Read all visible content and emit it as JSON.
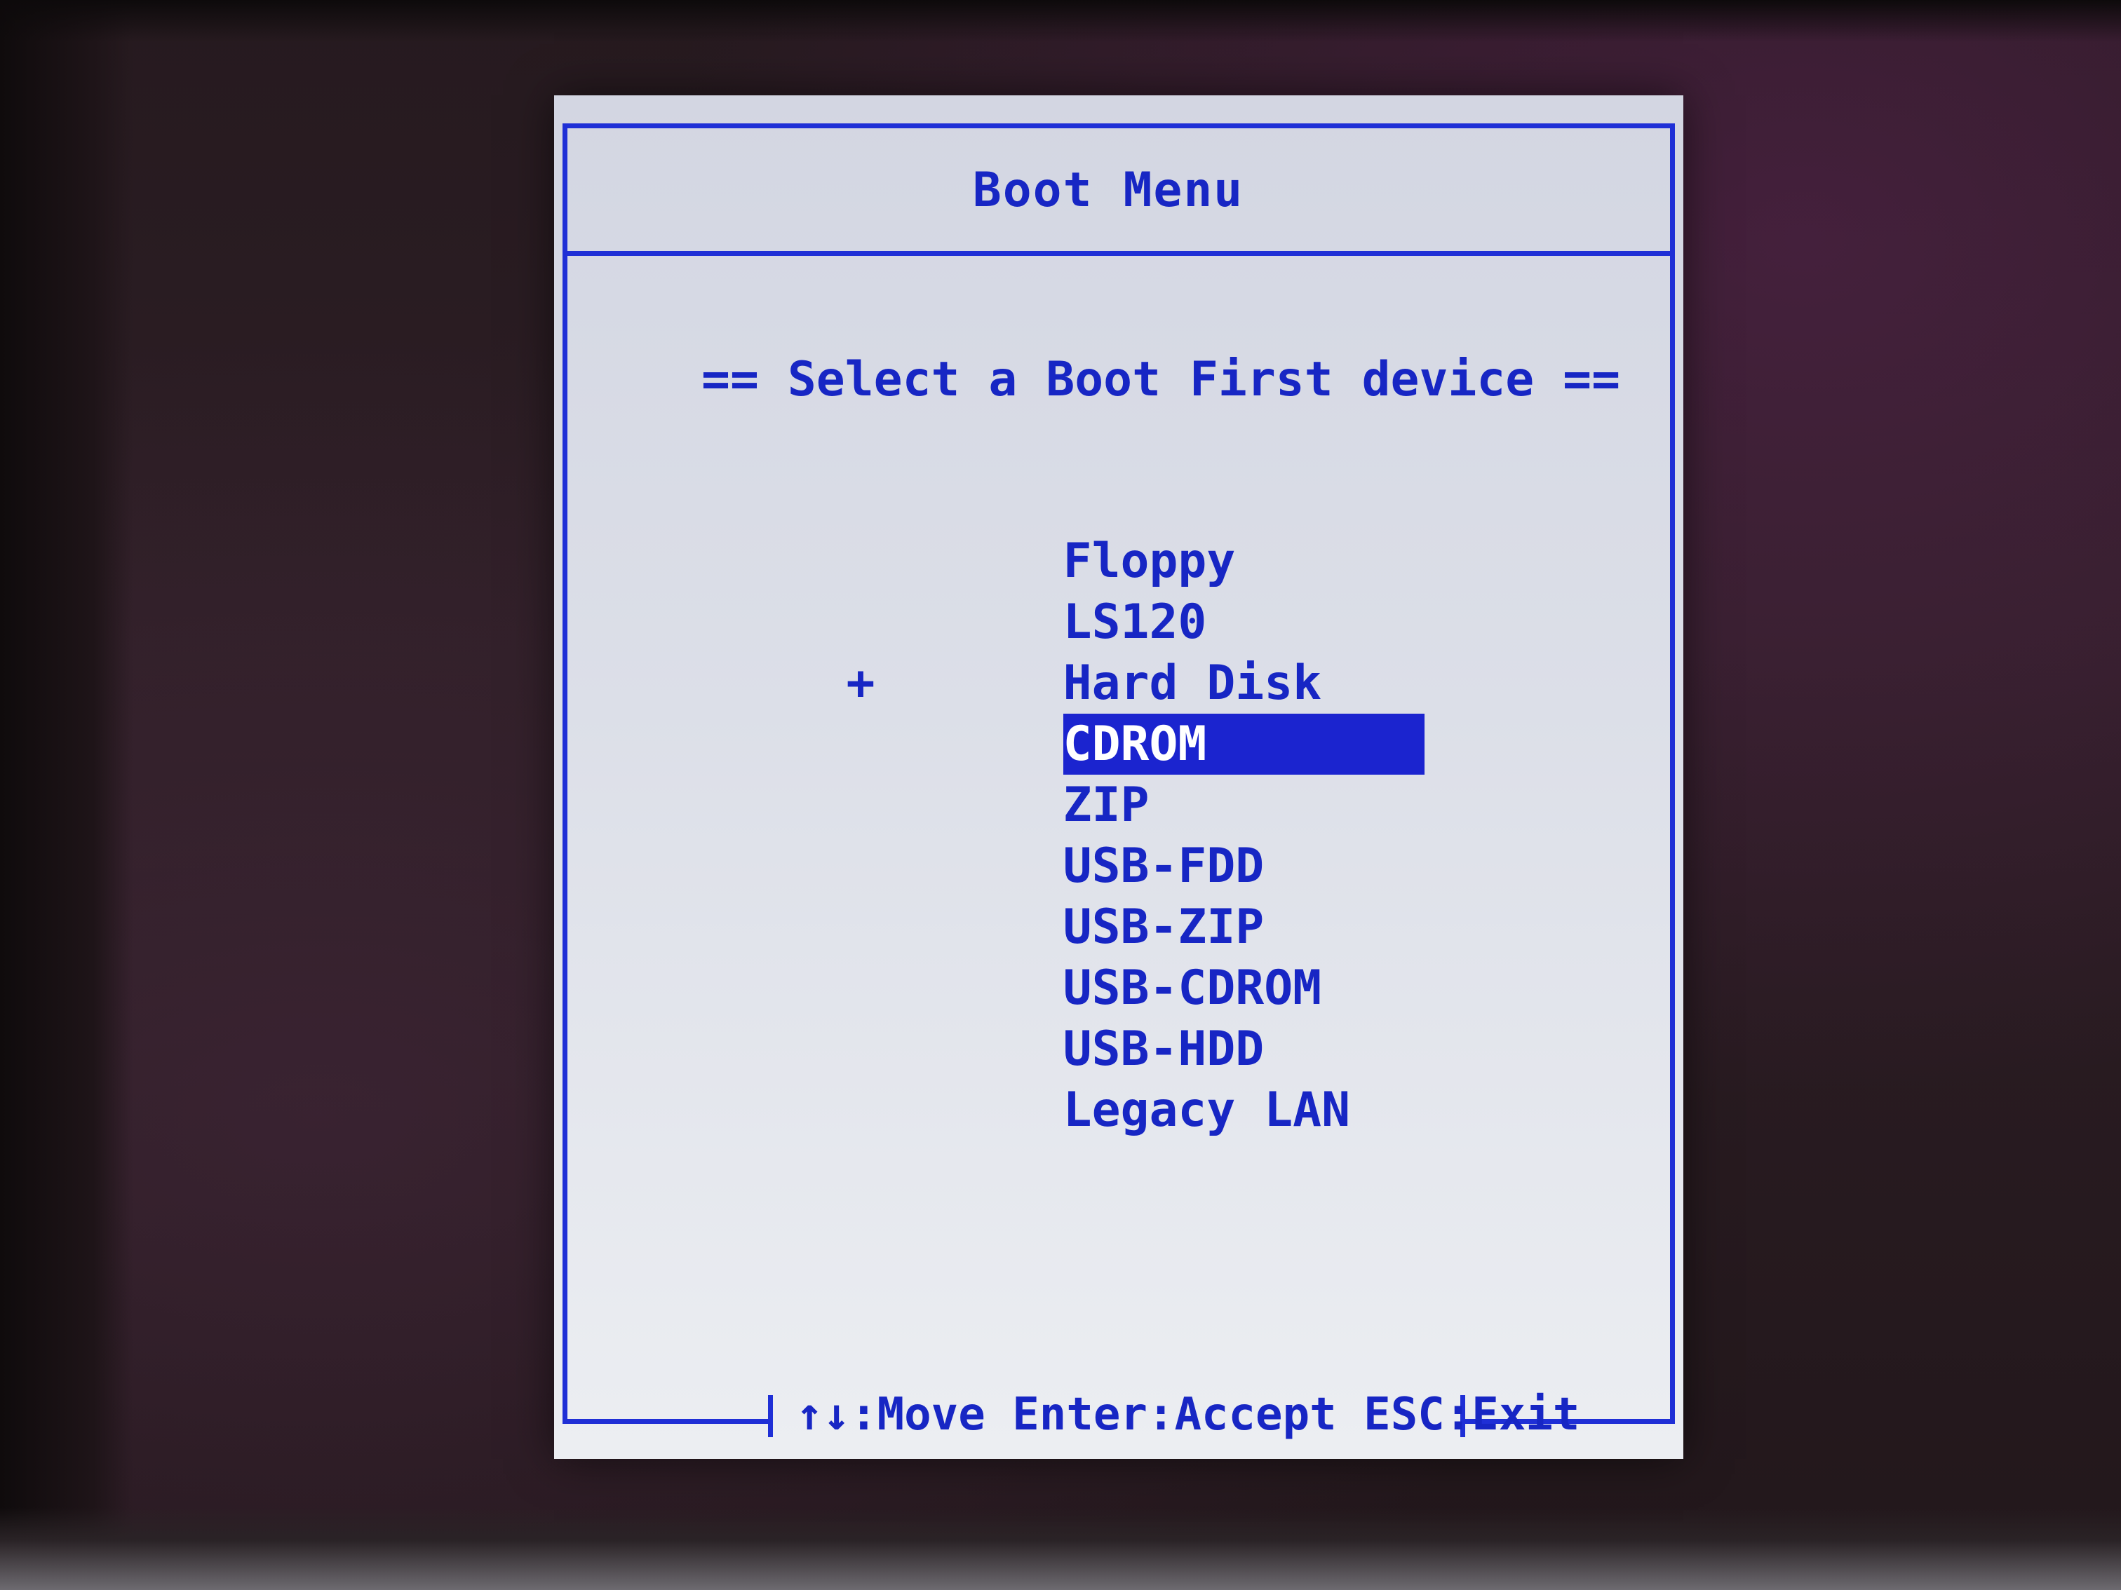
{
  "boot_menu": {
    "title": "Boot Menu",
    "prompt": "== Select a Boot First device ==",
    "current_boot_marker": "+",
    "selected_index": 3,
    "devices": [
      {
        "label": "Floppy",
        "marker": ""
      },
      {
        "label": "LS120",
        "marker": ""
      },
      {
        "label": "Hard Disk",
        "marker": "+"
      },
      {
        "label": "CDROM",
        "marker": ""
      },
      {
        "label": "ZIP",
        "marker": ""
      },
      {
        "label": "USB-FDD",
        "marker": ""
      },
      {
        "label": "USB-ZIP",
        "marker": ""
      },
      {
        "label": "USB-CDROM",
        "marker": ""
      },
      {
        "label": "USB-HDD",
        "marker": ""
      },
      {
        "label": "Legacy LAN",
        "marker": ""
      }
    ],
    "footer": "↑↓:Move Enter:Accept ESC:Exit"
  },
  "colors": {
    "text": "#1726c4",
    "frame": "#1f2fd6",
    "selection_bg": "#1b24cf",
    "selection_text": "#ffffff",
    "panel_bg": "#dcdfe8"
  }
}
